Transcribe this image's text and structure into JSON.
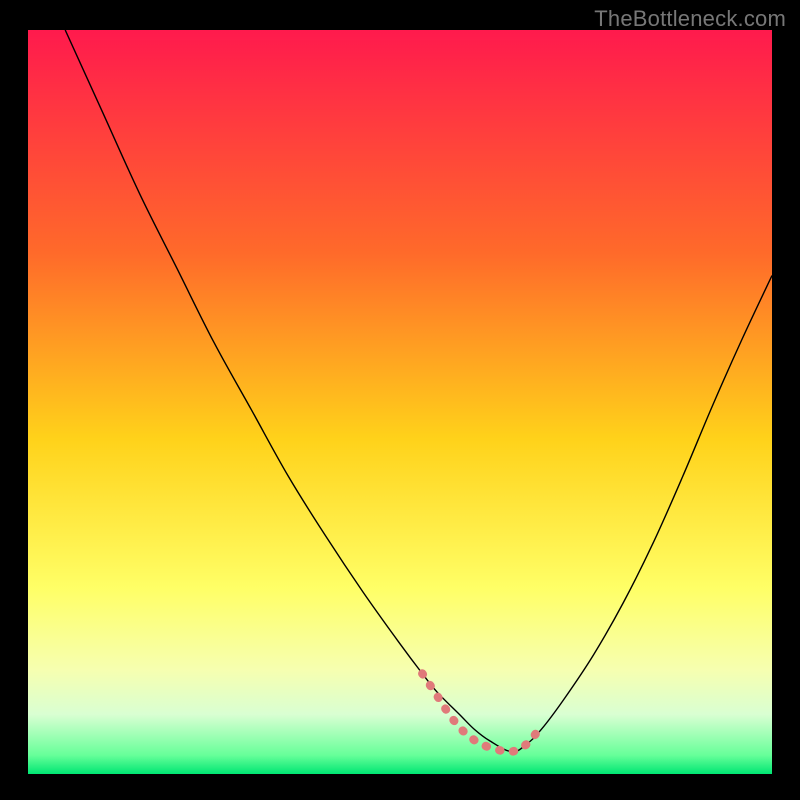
{
  "watermark": "TheBottleneck.com",
  "chart_data": {
    "type": "line",
    "title": "",
    "xlabel": "",
    "ylabel": "",
    "xlim": [
      0,
      100
    ],
    "ylim": [
      0,
      100
    ],
    "grid": false,
    "legend": false,
    "gradient_stops": [
      {
        "offset": 0.0,
        "color": "#ff1a4d"
      },
      {
        "offset": 0.3,
        "color": "#ff6a2a"
      },
      {
        "offset": 0.55,
        "color": "#ffd21a"
      },
      {
        "offset": 0.75,
        "color": "#ffff66"
      },
      {
        "offset": 0.86,
        "color": "#f6ffb0"
      },
      {
        "offset": 0.92,
        "color": "#d9ffd2"
      },
      {
        "offset": 0.975,
        "color": "#66ff99"
      },
      {
        "offset": 1.0,
        "color": "#00e673"
      }
    ],
    "series": [
      {
        "name": "bottleneck-curve",
        "stroke": "#000000",
        "stroke_width": 1.4,
        "x": [
          5,
          10,
          15,
          20,
          25,
          30,
          35,
          40,
          45,
          50,
          53,
          55,
          58,
          60,
          62,
          65,
          67,
          69,
          72,
          76,
          80,
          84,
          88,
          92,
          96,
          100
        ],
        "y": [
          100,
          89,
          78,
          68,
          58,
          49,
          40,
          32,
          24.5,
          17.5,
          13.5,
          11,
          8,
          6,
          4.5,
          3,
          4,
          6,
          10,
          16,
          23,
          31,
          40,
          49.5,
          58.5,
          67
        ]
      },
      {
        "name": "sweet-spot",
        "stroke": "#e07a7a",
        "stroke_width": 8.5,
        "linecap": "round",
        "dash": "1 13",
        "x": [
          53,
          55,
          57,
          59,
          61,
          63,
          65,
          67,
          68.7
        ],
        "y": [
          13.5,
          10.5,
          7.5,
          5.3,
          4.0,
          3.3,
          3.0,
          4.0,
          6.0
        ]
      }
    ]
  }
}
